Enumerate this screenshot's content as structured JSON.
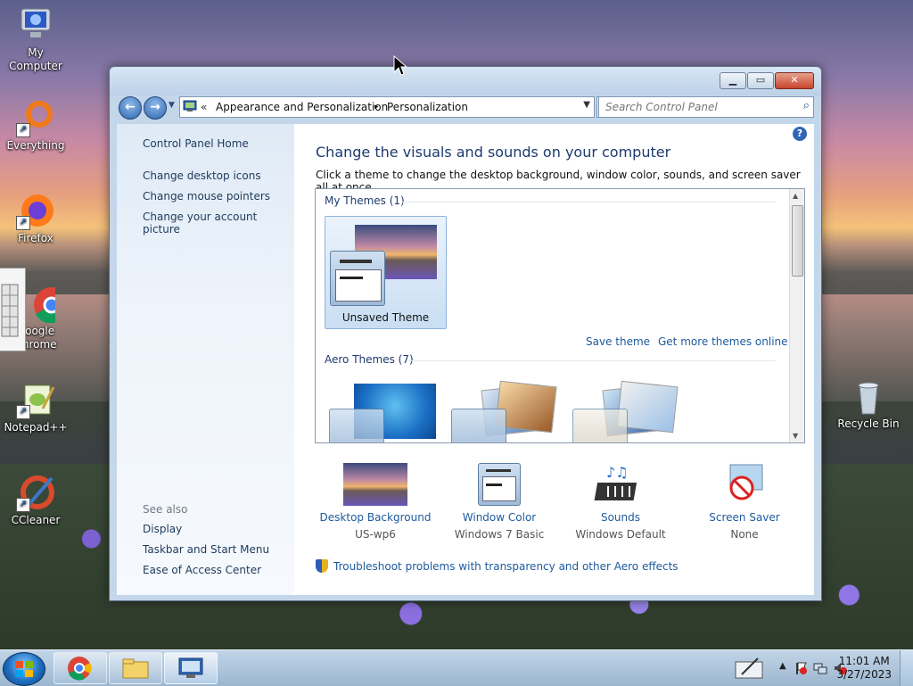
{
  "desktop": {
    "icons": [
      {
        "label": "My Computer"
      },
      {
        "label": "Everything"
      },
      {
        "label": "Firefox"
      },
      {
        "label": "Google Chrome"
      },
      {
        "label": "Notepad++"
      },
      {
        "label": "CCleaner"
      },
      {
        "label": "Recycle Bin"
      }
    ]
  },
  "window": {
    "address": {
      "sep": "«",
      "crumb1": "Appearance and Personalization",
      "arrow": "▸",
      "crumb2": "Personalization"
    },
    "search_placeholder": "Search Control Panel",
    "left": {
      "home": "Control Panel Home",
      "links": [
        "Change desktop icons",
        "Change mouse pointers",
        "Change your account picture"
      ],
      "see_also": "See also",
      "see_links": [
        "Display",
        "Taskbar and Start Menu",
        "Ease of Access Center"
      ]
    },
    "main": {
      "title": "Change the visuals and sounds on your computer",
      "desc": "Click a theme to change the desktop background, window color, sounds, and screen saver all at once.",
      "my_themes": "My Themes (1)",
      "unsaved_theme": "Unsaved Theme",
      "save_theme": "Save theme",
      "get_more": "Get more themes online",
      "aero_themes": "Aero Themes (7)",
      "bottom": [
        {
          "label": "Desktop Background",
          "value": "US-wp6"
        },
        {
          "label": "Window Color",
          "value": "Windows 7 Basic"
        },
        {
          "label": "Sounds",
          "value": "Windows Default"
        },
        {
          "label": "Screen Saver",
          "value": "None"
        }
      ],
      "troubleshoot": "Troubleshoot problems with transparency and other Aero effects"
    }
  },
  "taskbar": {
    "time": "11:01 AM",
    "date": "3/27/2023"
  }
}
